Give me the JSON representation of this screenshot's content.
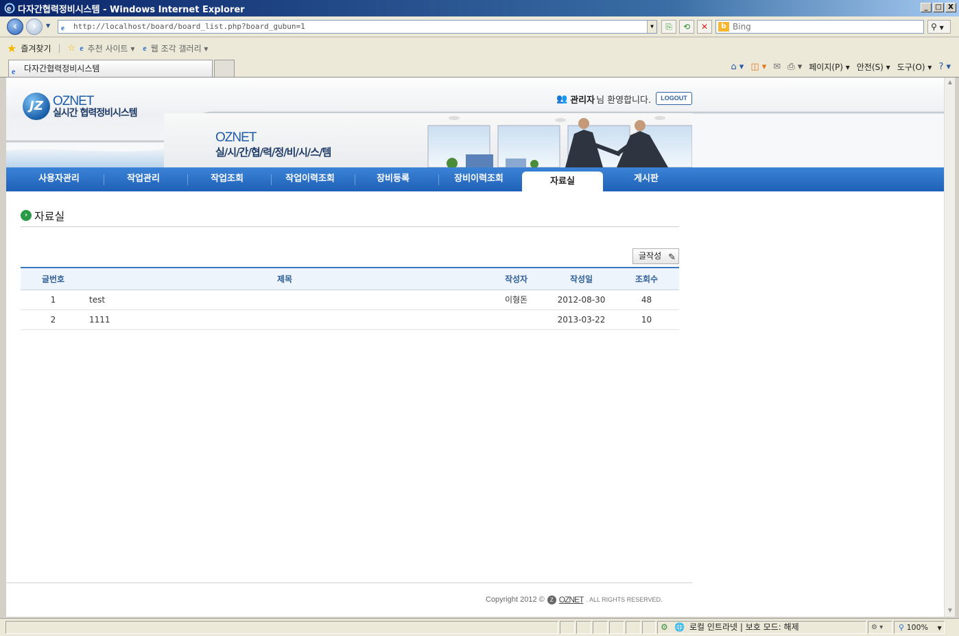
{
  "window": {
    "title": "다자간협력정비시스템 - Windows Internet Explorer",
    "buttons": [
      "_",
      "□",
      "X"
    ]
  },
  "browser": {
    "address": "http://localhost/board/board_list.php?board_gubun=1",
    "search_placeholder": "Bing",
    "favorites_label": "즐겨찾기",
    "fav_links": [
      "추천 사이트 ▾",
      "웹 조각 갤러리 ▾"
    ],
    "tab_title": "다자간협력정비시스템",
    "commands": [
      "페이지(P) ▾",
      "안전(S) ▾",
      "도구(O) ▾"
    ]
  },
  "site": {
    "logo_name": "OZNET",
    "logo_subtitle": "실시간 협력정비시스템",
    "welcome_user": "관리자",
    "welcome_text": "님 환영합니다.",
    "logout_label": "LOGOUT",
    "banner_name": "OZNET",
    "banner_subtitle": "실/시/간/협/력/정/비/시/스/템"
  },
  "menu": {
    "items": [
      "사용자관리",
      "작업관리",
      "작업조회",
      "작업이력조회",
      "장비등록",
      "장비이력조회",
      "자료실",
      "게시판"
    ],
    "active": "자료실"
  },
  "page": {
    "title": "자료실",
    "write_button": "글작성"
  },
  "table": {
    "headers": [
      "글번호",
      "제목",
      "작성자",
      "작성일",
      "조회수"
    ],
    "rows": [
      {
        "num": "1",
        "subject": "test",
        "author": "이형돈",
        "date": "2012-08-30",
        "hits": "48"
      },
      {
        "num": "2",
        "subject": "1111",
        "author": "",
        "date": "2013-03-22",
        "hits": "10"
      }
    ]
  },
  "footer": {
    "copyright": "Copyright 2012 ©",
    "brand": "OZNET",
    "rights": ". ALL RIGHTS RESERVED."
  },
  "status": {
    "zone": "로컬 인트라넷 | 보호 모드: 해제",
    "zoom": "100%"
  },
  "colors": {
    "menu_blue": "#1f61b8",
    "header_blue": "#2e5e96",
    "accent_green": "#2b9a46"
  }
}
